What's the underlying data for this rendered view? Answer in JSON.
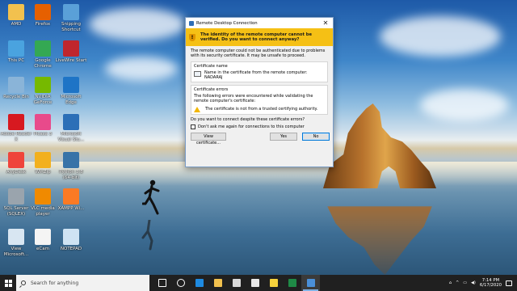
{
  "desktop": {
    "icons": [
      {
        "label": "AMD",
        "icon": "folder-icon",
        "color": "#f2c14e"
      },
      {
        "label": "Firefox",
        "icon": "firefox-icon",
        "color": "#e66000"
      },
      {
        "label": "Snipping Shortcut",
        "icon": "snipping-tool-icon",
        "color": "#5aa0d8"
      },
      {
        "label": "This PC",
        "icon": "computer-icon",
        "color": "#4aa3df"
      },
      {
        "label": "Google Chrome",
        "icon": "chrome-icon",
        "color": "#34a853"
      },
      {
        "label": "LiveWire Start",
        "icon": "livewire-icon",
        "color": "#c0262d"
      },
      {
        "label": "Recycle Bin",
        "icon": "recycle-bin-icon",
        "color": "#8ab4d8"
      },
      {
        "label": "NVIDIA GeForce",
        "icon": "nvidia-icon",
        "color": "#76b900"
      },
      {
        "label": "Microsoft Edge",
        "icon": "edge-icon",
        "color": "#1e74c6"
      },
      {
        "label": "Adobe Reader X",
        "icon": "acrobat-icon",
        "color": "#d71920"
      },
      {
        "label": "Picasa 3",
        "icon": "picasa-icon",
        "color": "#e84a8b"
      },
      {
        "label": "Microsoft Visual Stu...",
        "icon": "visual-studio-icon",
        "color": "#2c6fb7"
      },
      {
        "label": "AnyDesk",
        "icon": "anydesk-icon",
        "color": "#ef443b"
      },
      {
        "label": "WinZip",
        "icon": "winzip-icon",
        "color": "#f2b01e"
      },
      {
        "label": "Python 3.8 (64-bit)",
        "icon": "python-icon",
        "color": "#3773a8"
      },
      {
        "label": "SQL Server (SQLEX)",
        "icon": "sql-server-icon",
        "color": "#9aa4ad"
      },
      {
        "label": "VLC media player",
        "icon": "vlc-icon",
        "color": "#f08a00"
      },
      {
        "label": "XAMPP Wi...",
        "icon": "xampp-icon",
        "color": "#fb7a24"
      },
      {
        "label": "View Microsoft...",
        "icon": "document-icon",
        "color": "#d8e6f2"
      },
      {
        "label": "eCam",
        "icon": "camera-icon",
        "color": "#f4f4f4"
      },
      {
        "label": "NOTEPAD",
        "icon": "notepad-icon",
        "color": "#cfe3f3"
      }
    ]
  },
  "dialog": {
    "title": "Remote Desktop Connection",
    "close_label": "✕",
    "warning": "The identity of the remote computer cannot be verified. Do you want to connect anyway?",
    "intro": "The remote computer could not be authenticated due to problems with its security certificate. It may be unsafe to proceed.",
    "cert_name_heading": "Certificate name",
    "cert_name_caption": "Name in the certificate from the remote computer:",
    "cert_name_value": "NADARAJ",
    "cert_errors_heading": "Certificate errors",
    "cert_errors_caption": "The following errors were encountered while validating the remote computer's certificate:",
    "cert_error_1": "The certificate is not from a trusted certifying authority.",
    "question": "Do you want to connect despite these certificate errors?",
    "checkbox_label": "Don't ask me again for connections to this computer",
    "view_certificate_label": "View certificate...",
    "yes_label": "Yes",
    "no_label": "No"
  },
  "taskbar": {
    "search_placeholder": "Search for anything",
    "pinned": [
      {
        "name": "task-view-icon",
        "color": "#ffffff"
      },
      {
        "name": "cortana-icon",
        "color": "#ffffff"
      },
      {
        "name": "edge-icon",
        "color": "#1e8ae0"
      },
      {
        "name": "file-explorer-icon",
        "color": "#f2c14e"
      },
      {
        "name": "store-icon",
        "color": "#d9d9d9"
      },
      {
        "name": "mail-icon",
        "color": "#e8e8e8"
      },
      {
        "name": "sticky-notes-icon",
        "color": "#f7d23c"
      },
      {
        "name": "spreadsheet-icon",
        "color": "#1f8a46"
      },
      {
        "name": "remote-desktop-icon",
        "color": "#4a8fd8"
      }
    ],
    "time": "7:14 PM",
    "date": "6/17/2020"
  }
}
